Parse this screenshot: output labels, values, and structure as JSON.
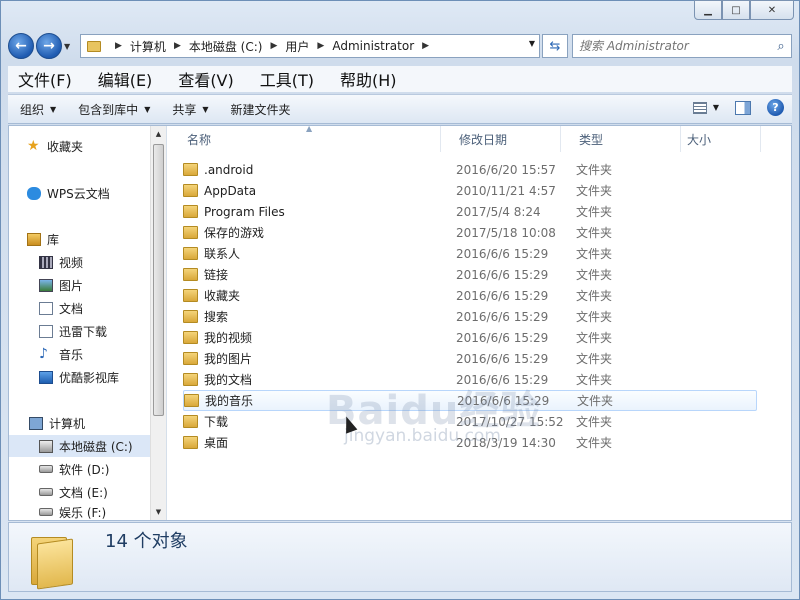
{
  "window": {
    "minimize_icon": "minimize-icon",
    "maximize_icon": "maximize-icon",
    "close_icon": "close-icon"
  },
  "address": {
    "crumbs": [
      "计算机",
      "本地磁盘 (C:)",
      "用户",
      "Administrator"
    ]
  },
  "search": {
    "placeholder": "搜索 Administrator"
  },
  "menu": [
    "文件(F)",
    "编辑(E)",
    "查看(V)",
    "工具(T)",
    "帮助(H)"
  ],
  "toolbar": {
    "organize": "组织",
    "include_library": "包含到库中",
    "share": "共享",
    "new_folder": "新建文件夹"
  },
  "nav": {
    "favorites": "收藏夹",
    "wps": "WPS云文档",
    "libraries": "库",
    "videos": "视频",
    "pictures": "图片",
    "documents": "文档",
    "thunder": "迅雷下载",
    "music": "音乐",
    "youku": "优酷影视库",
    "computer": "计算机",
    "c_drive": "本地磁盘 (C:)",
    "d_drive": "软件 (D:)",
    "e_drive": "文档 (E:)",
    "f_drive": "娱乐 (F:)"
  },
  "columns": {
    "name": "名称",
    "date": "修改日期",
    "type": "类型",
    "size": "大小"
  },
  "files": [
    {
      "name": ".android",
      "date": "2016/6/20 15:57",
      "type": "文件夹"
    },
    {
      "name": "AppData",
      "date": "2010/11/21 4:57",
      "type": "文件夹"
    },
    {
      "name": "Program Files",
      "date": "2017/5/4 8:24",
      "type": "文件夹"
    },
    {
      "name": "保存的游戏",
      "date": "2017/5/18 10:08",
      "type": "文件夹"
    },
    {
      "name": "联系人",
      "date": "2016/6/6 15:29",
      "type": "文件夹"
    },
    {
      "name": "链接",
      "date": "2016/6/6 15:29",
      "type": "文件夹"
    },
    {
      "name": "收藏夹",
      "date": "2016/6/6 15:29",
      "type": "文件夹"
    },
    {
      "name": "搜索",
      "date": "2016/6/6 15:29",
      "type": "文件夹"
    },
    {
      "name": "我的视频",
      "date": "2016/6/6 15:29",
      "type": "文件夹"
    },
    {
      "name": "我的图片",
      "date": "2016/6/6 15:29",
      "type": "文件夹"
    },
    {
      "name": "我的文档",
      "date": "2016/6/6 15:29",
      "type": "文件夹"
    },
    {
      "name": "我的音乐",
      "date": "2016/6/6 15:29",
      "type": "文件夹"
    },
    {
      "name": "下载",
      "date": "2017/10/27 15:52",
      "type": "文件夹"
    },
    {
      "name": "桌面",
      "date": "2018/3/19 14:30",
      "type": "文件夹"
    }
  ],
  "status": {
    "count": "14 个对象"
  },
  "watermark": {
    "logo": "Baidu经验",
    "url": "jingyan.baidu.com"
  }
}
